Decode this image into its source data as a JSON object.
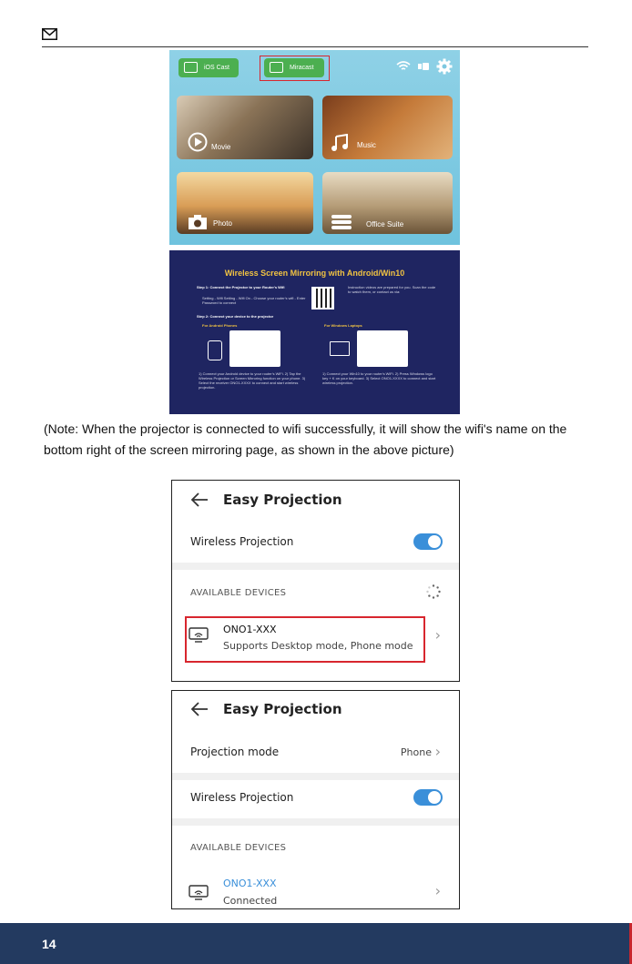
{
  "header": {
    "icon": "mail-icon"
  },
  "launcher": {
    "ios_cast": "iOS Cast",
    "miracast": "Miracast",
    "tiles": {
      "movie": "Movie",
      "music": "Music",
      "photo": "Photo",
      "office": "Office Suite"
    }
  },
  "guide": {
    "title": "Wireless Screen Mirroring with Android/Win10",
    "step1": "Step 1: Connect the Projector to your Router's Wifi",
    "step1_detail": "Setting - Wifi Setting - Wifi On - Choose your router's wifi - Enter Password to connect",
    "step2": "Step 2: Connect your device to the projector",
    "android_heading": "For Android Phones",
    "windows_heading": "For Windows Laptops",
    "qr_text": "Instruction videos are prepared for you. Scan the code to watch them, or contact us via:",
    "android_steps": "1) Connect your Android device to your router's WiFi. 2) Tap the Wireless Projection or Screen Mirroring function on your phone. 3) Select the receiver ONO1-XXXX to connect and start wireless projection.",
    "windows_steps": "1) Connect your Win10 to your router's WiFi. 2) Press Windows logo key + K on your keyboard. 3) Select ONO1-XXXX to connect and start wireless projection."
  },
  "note": "(Note: When the projector is connected to wifi successfully, it will show the wifi's name on the bottom right of the screen mirroring page, as shown in the above picture)",
  "screen1": {
    "title": "Easy Projection",
    "wireless_label": "Wireless Projection",
    "section": "AVAILABLE DEVICES",
    "device_name": "ONO1-XXX",
    "device_sub": "Supports Desktop mode, Phone mode"
  },
  "screen2": {
    "title": "Easy Projection",
    "mode_label": "Projection mode",
    "mode_value": "Phone",
    "wireless_label": "Wireless Projection",
    "section": "AVAILABLE DEVICES",
    "device_name": "ONO1-XXX",
    "device_status": "Connected"
  },
  "colors": {
    "accent_blue": "#3a8fd9",
    "highlight_red": "#d8262e",
    "footer_navy": "#233a60",
    "guide_bg": "#1f2561",
    "guide_title": "#f0c242"
  },
  "footer": {
    "page_number": "14"
  }
}
